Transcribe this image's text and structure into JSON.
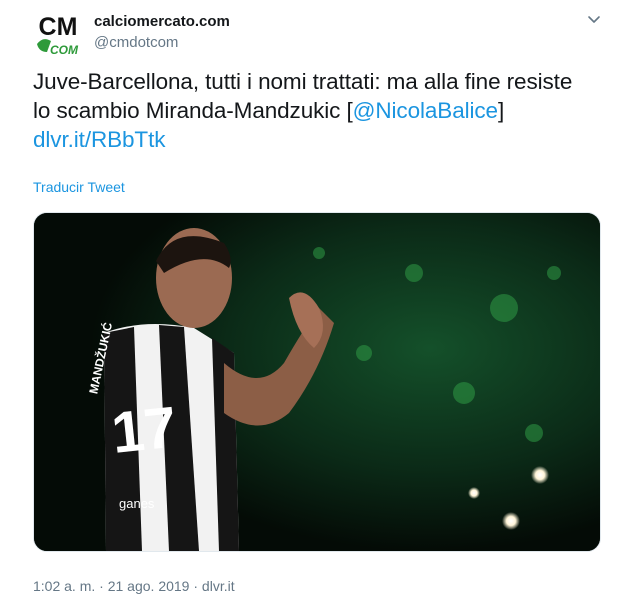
{
  "author": {
    "display_name": "calciomercato.com",
    "handle": "@cmdotcom",
    "avatar_text_top": "CM",
    "avatar_text_bottom": "COM"
  },
  "tweet": {
    "text_line1": "Juve-Barcellona, tutti i nomi trattati: ma alla fine resiste",
    "text_line2_prefix": "lo scambio Miranda-Mandzukic [",
    "mention": "@NicolaBalice",
    "text_line2_suffix": "]",
    "link": "dlvr.it/RBbTtk",
    "translate_label": "Traducir Tweet"
  },
  "media": {
    "jersey_text": "MANDŽUKIĆ",
    "jersey_number": "17",
    "sponsor_text": "ganes"
  },
  "meta": {
    "time": "1:02 a. m.",
    "separator": "·",
    "date": "21 ago. 2019",
    "source": "dlvr.it"
  },
  "colors": {
    "link": "#1b95e0",
    "secondary_text": "#657786",
    "avatar_green": "#2e9a3a"
  },
  "icons": {
    "caret": "chevron-down-icon"
  }
}
